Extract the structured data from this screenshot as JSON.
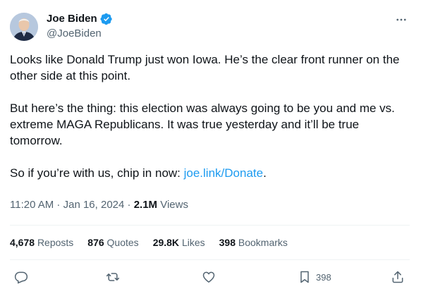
{
  "author": {
    "display_name": "Joe Biden",
    "handle": "@JoeBiden",
    "verified": true,
    "verified_color": "#1d9bf0"
  },
  "tweet": {
    "paragraphs": [
      {
        "text": "Looks like Donald Trump just won Iowa. He’s the clear front runner on the other side at this point."
      },
      {
        "text": "But here’s the thing: this election was always going to be you and me vs. extreme MAGA Republicans. It was true yesterday and it’ll be true tomorrow."
      },
      {
        "text_before_link": "So if you’re with us, chip in now: ",
        "link": "joe.link/Donate",
        "text_after_link": "."
      }
    ],
    "link_color": "#1d9bf0"
  },
  "meta": {
    "time": "11:20 AM",
    "separator": " · ",
    "date": "Jan 16, 2024",
    "views_count": "2.1M",
    "views_label": "Views"
  },
  "stats": {
    "reposts": {
      "count": "4,678",
      "label": "Reposts"
    },
    "quotes": {
      "count": "876",
      "label": "Quotes"
    },
    "likes": {
      "count": "29.8K",
      "label": "Likes"
    },
    "bookmarks": {
      "count": "398",
      "label": "Bookmarks"
    }
  },
  "actions": {
    "reply_icon": "reply-icon",
    "repost_icon": "repost-icon",
    "like_icon": "heart-icon",
    "bookmark_icon": "bookmark-icon",
    "bookmark_count": "398",
    "share_icon": "share-icon"
  },
  "colors": {
    "text": "#0f1419",
    "secondary": "#536471",
    "divider": "#eff3f4"
  }
}
